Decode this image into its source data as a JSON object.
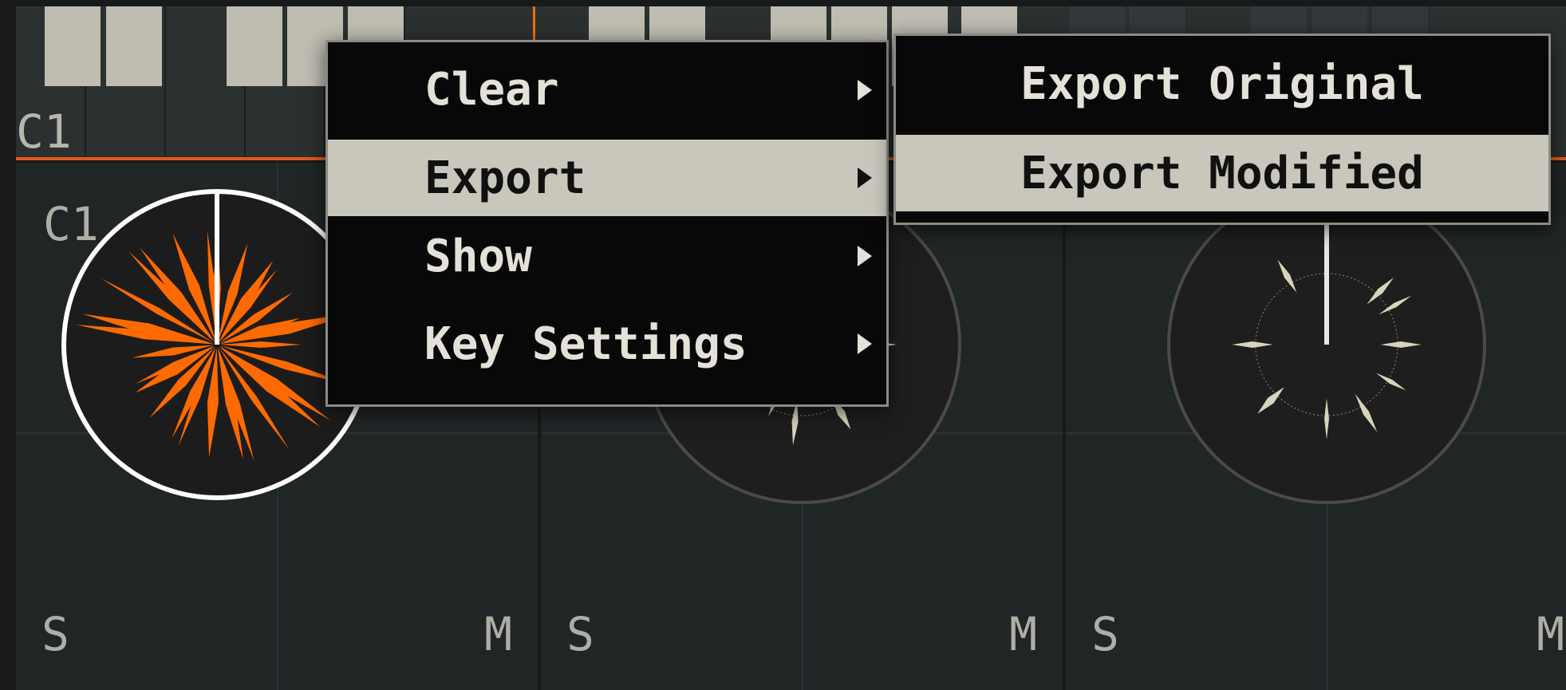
{
  "keyboard": {
    "octave_label": "C1"
  },
  "pads": [
    {
      "note": "C1",
      "solo_label": "S",
      "mute_label": "M",
      "active": true
    },
    {
      "note": "",
      "solo_label": "S",
      "mute_label": "M",
      "active": false
    },
    {
      "note": "",
      "solo_label": "S",
      "mute_label": "M",
      "active": false
    }
  ],
  "context_menu": {
    "items": [
      {
        "label": "Clear",
        "has_submenu": true,
        "highlighted": false
      },
      {
        "label": "Export",
        "has_submenu": true,
        "highlighted": true
      },
      {
        "label": "Show",
        "has_submenu": true,
        "highlighted": false
      },
      {
        "label": "Key Settings",
        "has_submenu": true,
        "highlighted": false
      }
    ]
  },
  "export_submenu": {
    "items": [
      {
        "label": "Export Original",
        "highlighted": false
      },
      {
        "label": "Export Modified",
        "highlighted": true
      }
    ]
  },
  "colors": {
    "accent": "#ff6a00",
    "menu_highlight": "#c9c6bc",
    "menu_bg": "#080808",
    "pad_bg": "#202526",
    "ring_active": "#ffffff",
    "ring_idle": "#4a4a48",
    "spikes_idle": "#d8d3bd"
  }
}
